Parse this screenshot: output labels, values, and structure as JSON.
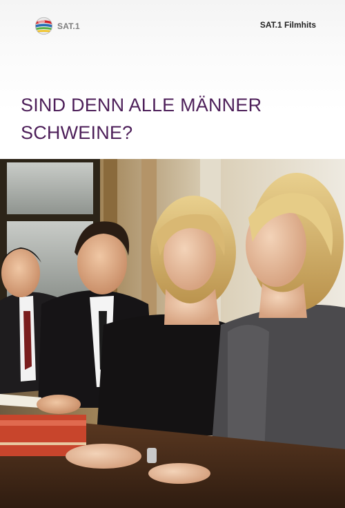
{
  "header": {
    "brand_left": "SAT.1",
    "brand_right": "SAT.1 Filmhits",
    "logo_icon": "sat1-ball-logo-icon",
    "colors": {
      "title": "#4d1f59",
      "logo_red": "#d2232a",
      "logo_blue": "#2a6db6",
      "logo_green": "#4fae3c",
      "logo_yellow": "#f2c21b"
    }
  },
  "title_lines": [
    "SIND DENN ALLE MÄNNER",
    "SCHWEINE?"
  ]
}
